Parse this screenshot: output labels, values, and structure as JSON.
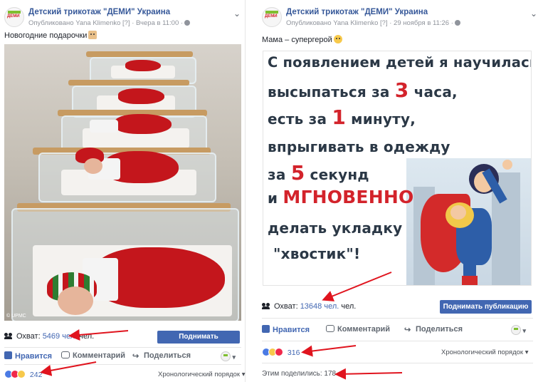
{
  "posts": [
    {
      "page_name": "Детский трикотаж \"ДЕМИ\" Украина",
      "published_by": "Опубликовано Yana Klimenko [?] · Вчера в 11:00 ·",
      "text": "Новогодние подарочки",
      "photo_credit": "© UPMC",
      "reach_label": "Охват:",
      "reach_value": "5469 чел.",
      "reach_suffix": "чел.",
      "promote_label": "Поднимать публикацию",
      "actions": {
        "like": "Нравится",
        "comment": "Комментарий",
        "share": "Поделиться"
      },
      "reactions_count": "242",
      "order_label": "Хронологический порядок ▾"
    },
    {
      "page_name": "Детский трикотаж \"ДЕМИ\" Украина",
      "published_by": "Опубликовано Yana Klimenko [?] · 29 ноября в 11:26 ·",
      "text": "Мама – супергерой",
      "poster": {
        "line1": "С появлением детей я научилась",
        "line2_a": "высыпаться за ",
        "line2_num": "3",
        "line2_b": " часа,",
        "line3_a": "есть за ",
        "line3_num": "1",
        "line3_b": " минуту,",
        "line4": "впрыгивать в одежду",
        "line5_a": "за ",
        "line5_num": "5",
        "line5_b": " секунд",
        "line6_a": "и ",
        "line6_big": "МГНОВЕННО",
        "line7": "делать укладку",
        "line8": "\"хвостик\"!"
      },
      "reach_label": "Охват:",
      "reach_value": "13648 чел.",
      "reach_suffix": "чел.",
      "promote_label": "Поднимать публикацию",
      "actions": {
        "like": "Нравится",
        "comment": "Комментарий",
        "share": "Поделиться"
      },
      "reactions_count": "316",
      "order_label": "Хронологический порядок ▾",
      "shared_label": "Этим поделились: 178"
    }
  ],
  "colors": {
    "link": "#365899",
    "accent": "#4267b2",
    "arrow": "#e0141e",
    "poster_red": "#d3232b"
  }
}
